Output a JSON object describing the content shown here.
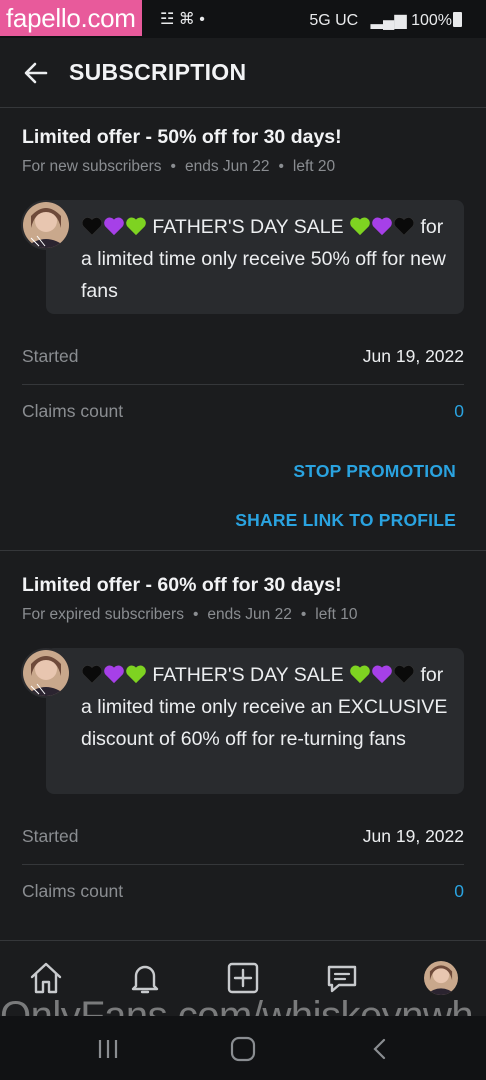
{
  "watermark": {
    "top": "fapello.com",
    "bottom": "OnlyFans.com/whiskeynwh"
  },
  "status_bar": {
    "left_icons": "☳ ⌘ •",
    "network": "5G UC",
    "battery": "100%"
  },
  "header": {
    "title": "SUBSCRIPTION",
    "back_icon": "arrow-left-icon"
  },
  "offers": [
    {
      "title": "Limited offer - 50% off for 30 days!",
      "audience": "For new subscribers",
      "ends": "ends Jun 22",
      "left": "left 20",
      "message_head": "FATHER'S DAY SALE",
      "message_body": "for a limited time only receive 50% off for new fans",
      "started_label": "Started",
      "started_value": "Jun 19, 2022",
      "claims_label": "Claims count",
      "claims_value": "0",
      "stop_label": "STOP PROMOTION",
      "share_label": "SHARE LINK TO PROFILE"
    },
    {
      "title": "Limited offer - 60% off for 30 days!",
      "audience": "For expired subscribers",
      "ends": "ends Jun 22",
      "left": "left 10",
      "message_head": "FATHER'S DAY SALE",
      "message_body": "for a limited time only receive an EXCLUSIVE discount of 60% off for re-turning fans",
      "started_label": "Started",
      "started_value": "Jun 19, 2022",
      "claims_label": "Claims count",
      "claims_value": "0"
    }
  ],
  "colors": {
    "accent": "#2aa3e0",
    "background": "#1b1c1e",
    "bubble": "#292b2e",
    "muted": "#8a8d91",
    "watermark_pink": "#e85a9b"
  },
  "bottom_nav": [
    "home-icon",
    "bell-icon",
    "plus-square-icon",
    "message-icon",
    "profile-avatar"
  ],
  "system_nav": [
    "recent-apps-icon",
    "home-circle-icon",
    "back-chevron-icon"
  ]
}
